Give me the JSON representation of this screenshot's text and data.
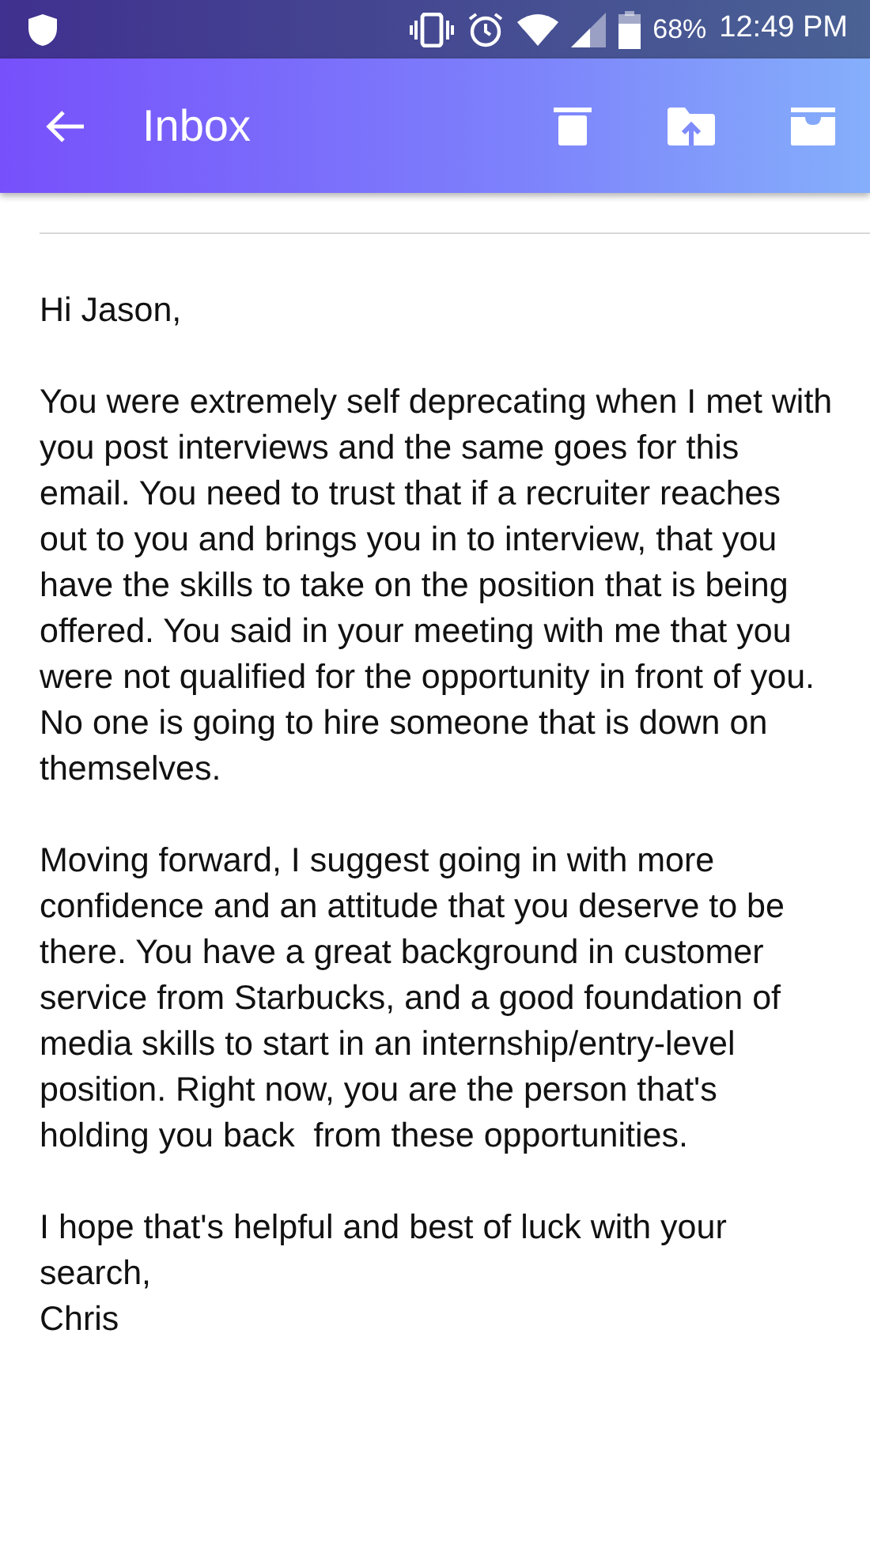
{
  "status_bar": {
    "battery": "68%",
    "time": "12:49 PM"
  },
  "toolbar": {
    "title": "Inbox"
  },
  "email": {
    "paragraphs": [
      "Hi Jason,",
      "You were extremely self deprecating when I met with you post interviews and the same goes for this email. You need to trust that if a recruiter reaches out to you and brings you in to interview, that you have the skills to take on the position that is being offered. You said in your meeting with me that you were not qualified for the opportunity in front of you. No one is going to hire someone that is down on themselves.",
      "Moving forward, I suggest going in with more confidence and an attitude that you deserve to be there. You have a great background in customer service from Starbucks, and a good foundation of media skills to start in an internship/entry-level position. Right now, you are the person that's holding you back  from these opportunities.",
      "I hope that's helpful and best of luck with your search,"
    ],
    "signature": "Chris"
  }
}
